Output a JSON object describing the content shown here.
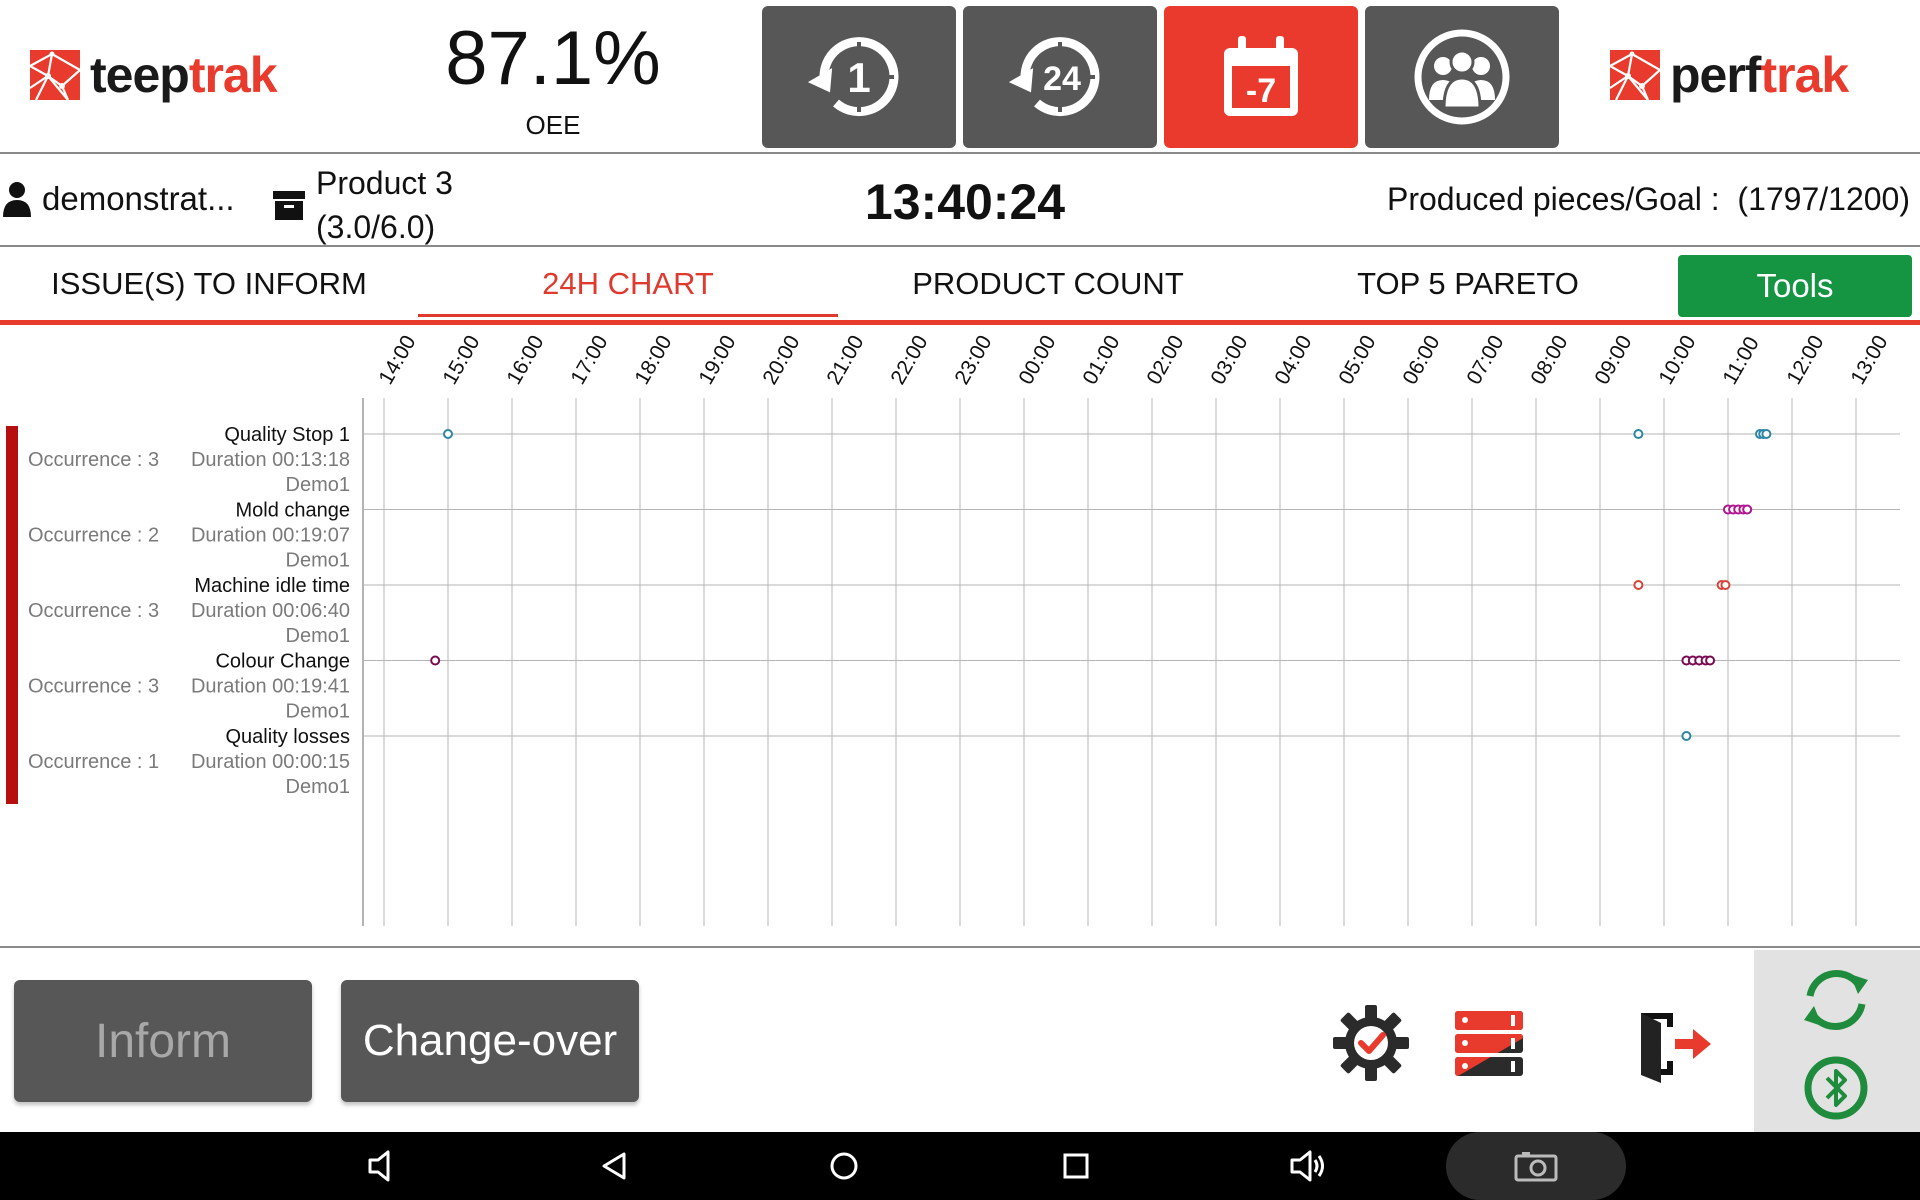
{
  "header": {
    "logo_left": {
      "part1": "teep",
      "part2": "trak"
    },
    "logo_right": {
      "part1": "perf",
      "part2": "trak"
    },
    "oee_value": "87.1%",
    "oee_label": "OEE",
    "buttons": [
      {
        "icon": "history-1h-icon",
        "label": "1"
      },
      {
        "icon": "history-24h-icon",
        "label": "24"
      },
      {
        "icon": "calendar-7-icon",
        "label": "-7",
        "active": true
      },
      {
        "icon": "team-icon",
        "label": ""
      }
    ]
  },
  "infobar": {
    "user": "demonstrat...",
    "product_line1": "Product 3",
    "product_line2": "(3.0/6.0)",
    "clock": "13:40:24",
    "produced": "Produced pieces/Goal :  (1797/1200)"
  },
  "tabs": [
    {
      "label": "ISSUE(S) TO INFORM"
    },
    {
      "label": "24H CHART",
      "active": true
    },
    {
      "label": "PRODUCT COUNT"
    },
    {
      "label": "TOP 5 PARETO"
    }
  ],
  "tools_label": "Tools",
  "chart_data": {
    "type": "scatter",
    "ticks": [
      "14:00",
      "15:00",
      "16:00",
      "17:00",
      "18:00",
      "19:00",
      "20:00",
      "21:00",
      "22:00",
      "23:00",
      "00:00",
      "01:00",
      "02:00",
      "03:00",
      "04:00",
      "05:00",
      "06:00",
      "07:00",
      "08:00",
      "09:00",
      "10:00",
      "11:00",
      "12:00",
      "13:00"
    ],
    "start_hour": 13.67,
    "issues": [
      {
        "name": "Quality Stop 1",
        "occurrence": "Occurrence : 3",
        "duration": "Duration 00:13:18",
        "machine": "Demo1",
        "color": "#2e86a6",
        "events": [
          15.0,
          9.6,
          11.5,
          11.55,
          11.6
        ]
      },
      {
        "name": "Mold change",
        "occurrence": "Occurrence : 2",
        "duration": "Duration 00:19:07",
        "machine": "Demo1",
        "color": "#b0168f",
        "events": [
          11.0,
          11.08,
          11.16,
          11.24,
          11.3
        ]
      },
      {
        "name": "Machine idle time",
        "occurrence": "Occurrence : 3",
        "duration": "Duration 00:06:40",
        "machine": "Demo1",
        "color": "#d9433a",
        "events": [
          9.6,
          10.9,
          10.96
        ]
      },
      {
        "name": "Colour Change",
        "occurrence": "Occurrence : 3",
        "duration": "Duration 00:19:41",
        "machine": "Demo1",
        "color": "#7a0b52",
        "events": [
          14.8,
          10.35,
          10.45,
          10.55,
          10.65,
          10.72
        ]
      },
      {
        "name": "Quality losses",
        "occurrence": "Occurrence : 1",
        "duration": "Duration 00:00:15",
        "machine": "Demo1",
        "color": "#2e86a6",
        "events": [
          10.35
        ]
      }
    ]
  },
  "footer": {
    "inform_label": "Inform",
    "changeover_label": "Change-over",
    "icons": [
      "settings-check-icon",
      "server-icon",
      "logout-icon",
      "sync-icon",
      "bluetooth-icon"
    ]
  },
  "colors": {
    "accent": "#e83a2d",
    "dark_button": "#575757",
    "tools_green": "#159441",
    "sync_green": "#1e8c3c"
  },
  "navbar": {
    "icons": [
      "volume-down-icon",
      "back-icon",
      "home-icon",
      "recents-icon",
      "volume-up-icon",
      "screenshot-icon"
    ]
  }
}
